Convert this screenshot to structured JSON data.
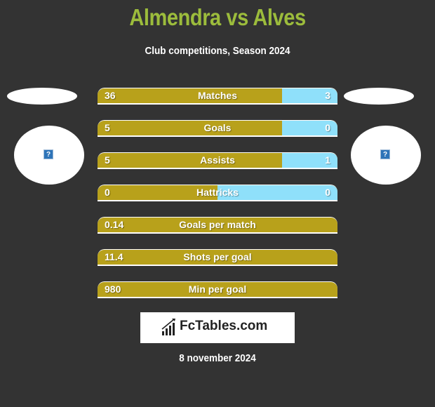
{
  "header": {
    "title": "Almendra vs Alves",
    "subtitle": "Club competitions, Season 2024"
  },
  "players": {
    "left": {
      "image_icon": "broken-image-icon",
      "icon_glyph": "?"
    },
    "right": {
      "image_icon": "broken-image-icon",
      "icon_glyph": "?"
    }
  },
  "colors": {
    "title": "#9cbc3c",
    "left_bar": "#b8a11b",
    "right_bar": "#8fe0fa",
    "background": "#333333"
  },
  "stats": [
    {
      "label": "Matches",
      "left": "36",
      "right": "3",
      "right_share": 0.23
    },
    {
      "label": "Goals",
      "left": "5",
      "right": "0",
      "right_share": 0.23
    },
    {
      "label": "Assists",
      "left": "5",
      "right": "1",
      "right_share": 0.23
    },
    {
      "label": "Hattricks",
      "left": "0",
      "right": "0",
      "right_share": 0.5
    },
    {
      "label": "Goals per match",
      "left": "0.14",
      "right": "",
      "right_share": 0
    },
    {
      "label": "Shots per goal",
      "left": "11.4",
      "right": "",
      "right_share": 0
    },
    {
      "label": "Min per goal",
      "left": "980",
      "right": "",
      "right_share": 0
    }
  ],
  "footer": {
    "logo_text": "FcTables.com",
    "date": "8 november 2024"
  }
}
